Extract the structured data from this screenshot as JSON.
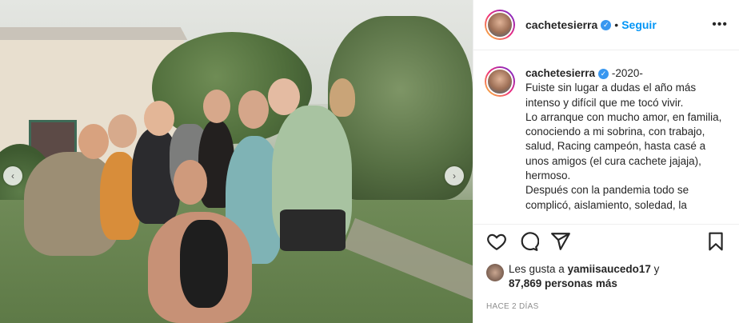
{
  "header": {
    "username": "cachetesierra",
    "separator": "•",
    "follow_label": "Seguir",
    "more_label": "•••"
  },
  "caption": {
    "username": "cachetesierra",
    "lines": [
      "-2020-",
      "Fuiste sin lugar a dudas el año más intenso y difícil que me tocó vivir.",
      "Lo arranque con mucho amor, en familia, conociendo a mi sobrina, con trabajo, salud, Racing campeón, hasta casé a unos amigos (el cura cachete jajaja), hermoso.",
      "Después con la pandemia todo se complicó, aislamiento, soledad, la"
    ]
  },
  "likes": {
    "prefix": "Les gusta a ",
    "liker": "yamiisaucedo17",
    "conj": " y",
    "count": "87,869 personas más"
  },
  "date": "HACE 2 DÍAS",
  "carousel": {
    "prev": "‹",
    "next": "›"
  },
  "icons": {
    "like": "heart-icon",
    "comment": "comment-icon",
    "share": "share-icon",
    "save": "bookmark-icon",
    "verified": "verified-badge-icon"
  },
  "colors": {
    "follow": "#0095f6",
    "verified": "#3897f0",
    "date": "#8e8e8e"
  }
}
